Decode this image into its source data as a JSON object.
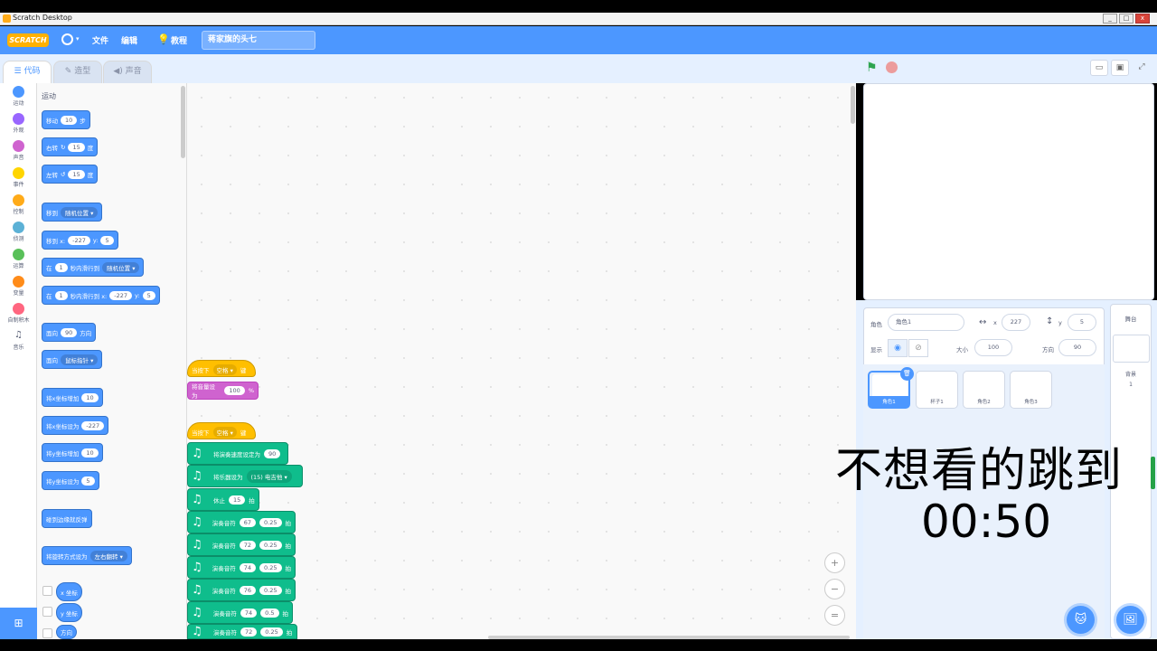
{
  "window": {
    "title": "Scratch Desktop",
    "min": "_",
    "max": "□",
    "close": "x"
  },
  "menubar": {
    "logo": "SCRATCH",
    "lang_caret": "▾",
    "file": "文件",
    "edit": "编辑",
    "tutorial_icon": "💡",
    "tutorial": "教程",
    "project_title": "蒋家旗的头七"
  },
  "tabs": [
    {
      "icon": "☰",
      "label": "代码"
    },
    {
      "icon": "✎",
      "label": "造型"
    },
    {
      "icon": "◀)",
      "label": "声音"
    }
  ],
  "categories": [
    {
      "label": "运动",
      "color": "#4c97ff"
    },
    {
      "label": "外观",
      "color": "#9966ff"
    },
    {
      "label": "声音",
      "color": "#cf63cf"
    },
    {
      "label": "事件",
      "color": "#ffd500"
    },
    {
      "label": "控制",
      "color": "#ffab19"
    },
    {
      "label": "侦测",
      "color": "#5cb1d6"
    },
    {
      "label": "运算",
      "color": "#59c059"
    },
    {
      "label": "变量",
      "color": "#ff8c1a"
    },
    {
      "label": "自制积木",
      "color": "#ff6680"
    },
    {
      "label": "音乐",
      "color": "#0fbd8c"
    }
  ],
  "palette": {
    "section": "运动",
    "move": {
      "a": "移动",
      "v": "10",
      "b": "步"
    },
    "turn_right": {
      "a": "右转",
      "icon": "↻",
      "v": "15",
      "b": "度"
    },
    "turn_left": {
      "a": "左转",
      "icon": "↺",
      "v": "15",
      "b": "度"
    },
    "goto": {
      "a": "移到",
      "dd": "随机位置 ▾"
    },
    "goto_xy": {
      "a": "移到 x:",
      "x": "-227",
      "b": "y:",
      "y": "5"
    },
    "glide": {
      "a": "在",
      "v": "1",
      "b": "秒内滑行到",
      "dd": "随机位置 ▾"
    },
    "glide_xy": {
      "a": "在",
      "v": "1",
      "b": "秒内滑行到 x:",
      "x": "-227",
      "c": "y:",
      "y": "5"
    },
    "point_dir": {
      "a": "面向",
      "v": "90",
      "b": "方向"
    },
    "point_towards": {
      "a": "面向",
      "dd": "鼠标指针 ▾"
    },
    "change_x": {
      "a": "将x坐标增加",
      "v": "10"
    },
    "set_x": {
      "a": "将x坐标设为",
      "v": "-227"
    },
    "change_y": {
      "a": "将y坐标增加",
      "v": "10"
    },
    "set_y": {
      "a": "将y坐标设为",
      "v": "5"
    },
    "bounce": "碰到边缘就反弹",
    "rotation": {
      "a": "将旋转方式设为",
      "dd": "左右翻转 ▾"
    },
    "xpos": "x 坐标",
    "ypos": "y 坐标",
    "dir": "方向"
  },
  "scripts": {
    "hat1": {
      "a": "当按下",
      "dd": "空格 ▾",
      "b": "键"
    },
    "volume": {
      "a": "将音量设为",
      "v": "100",
      "b": "%"
    },
    "hat2": {
      "a": "当按下",
      "dd": "空格 ▾",
      "b": "键"
    },
    "music_blocks": [
      {
        "a": "将演奏速度设定为",
        "v": "90",
        "b": ""
      },
      {
        "a": "将乐器设为",
        "dd": "(15) 电吉他 ▾"
      },
      {
        "a": "休止",
        "v": "15",
        "b": "拍"
      },
      {
        "a": "演奏音符",
        "v": "67",
        "v2": "0.25",
        "b": "拍"
      },
      {
        "a": "演奏音符",
        "v": "72",
        "v2": "0.25",
        "b": "拍"
      },
      {
        "a": "演奏音符",
        "v": "74",
        "v2": "0.25",
        "b": "拍"
      },
      {
        "a": "演奏音符",
        "v": "76",
        "v2": "0.25",
        "b": "拍"
      },
      {
        "a": "演奏音符",
        "v": "74",
        "v2": "0.5",
        "b": "拍"
      },
      {
        "a": "演奏音符",
        "v": "72",
        "v2": "0.25",
        "b": "拍"
      }
    ],
    "note_icon": "♫"
  },
  "zoom": {
    "in": "+",
    "out": "−",
    "reset": "="
  },
  "stage": {
    "flag": "⚑",
    "layout_small": "▭",
    "layout_large": "▣",
    "fullscreen": "⤢"
  },
  "sprite_info": {
    "sprite_label": "角色",
    "sprite_name": "角色1",
    "x_icon": "↔",
    "x_label": "x",
    "x_value": "227",
    "y_icon": "↕",
    "y_label": "y",
    "y_value": "5",
    "show_label": "显示",
    "eye_on": "◉",
    "eye_off": "⊘",
    "size_label": "大小",
    "size_value": "100",
    "dir_label": "方向",
    "dir_value": "90"
  },
  "sprites": [
    "角色1",
    "杯子1",
    "角色2",
    "角色3"
  ],
  "trash_icon": "🗑",
  "stage_col": {
    "header": "舞台",
    "bg_label": "背景",
    "bg_count": "1"
  },
  "fab_sprite": "🐱",
  "fab_backdrop": "🖼",
  "ext_icon": "⊞",
  "overlay": {
    "line1": "不想看的跳到",
    "line2": "00:50"
  }
}
